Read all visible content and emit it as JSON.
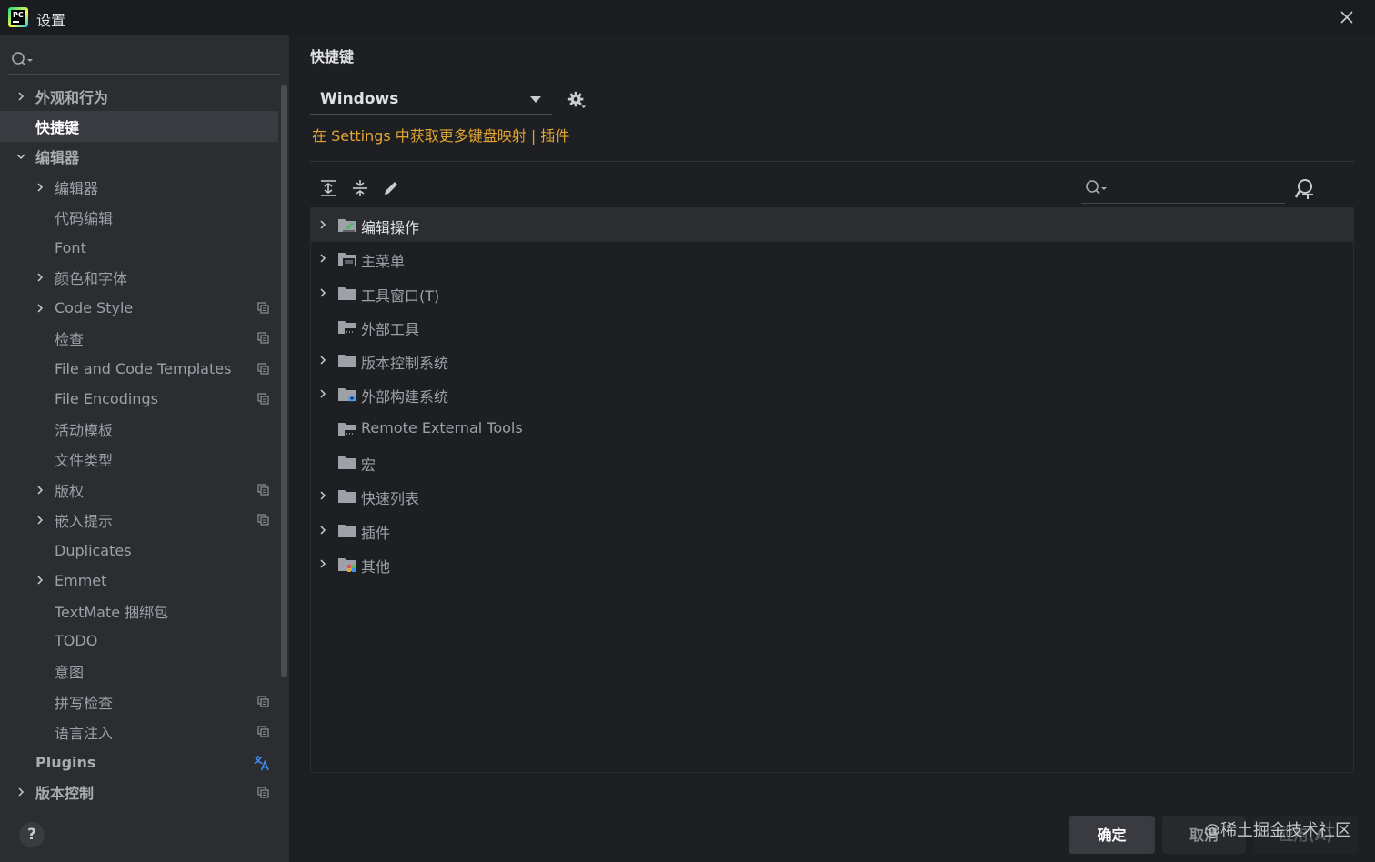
{
  "window": {
    "title": "设置",
    "app_icon": "pycharm-logo",
    "app_icon_text": "PC"
  },
  "colors": {
    "accent_link": "#e0a533",
    "background": "#1e1f22",
    "sidebar": "#2b2d30",
    "selection": "#393b40"
  },
  "left_search": {
    "placeholder": "",
    "icon": "search-icon"
  },
  "nav": [
    {
      "label": "外观和行为",
      "level": 0,
      "expandable": true,
      "expanded": false
    },
    {
      "label": "快捷键",
      "level": 0,
      "selected": true
    },
    {
      "label": "编辑器",
      "level": 0,
      "expandable": true,
      "expanded": true
    },
    {
      "label": "编辑器",
      "level": 1,
      "expandable": true
    },
    {
      "label": "代码编辑",
      "level": 1
    },
    {
      "label": "Font",
      "level": 1
    },
    {
      "label": "颜色和字体",
      "level": 1,
      "expandable": true
    },
    {
      "label": "Code Style",
      "level": 1,
      "expandable": true,
      "badge": "project-scope-icon"
    },
    {
      "label": "检查",
      "level": 1,
      "badge": "project-scope-icon"
    },
    {
      "label": "File and Code Templates",
      "level": 1,
      "badge": "project-scope-icon"
    },
    {
      "label": "File Encodings",
      "level": 1,
      "badge": "project-scope-icon"
    },
    {
      "label": "活动模板",
      "level": 1
    },
    {
      "label": "文件类型",
      "level": 1
    },
    {
      "label": "版权",
      "level": 1,
      "expandable": true,
      "badge": "project-scope-icon"
    },
    {
      "label": "嵌入提示",
      "level": 1,
      "expandable": true,
      "badge": "project-scope-icon"
    },
    {
      "label": "Duplicates",
      "level": 1
    },
    {
      "label": "Emmet",
      "level": 1,
      "expandable": true
    },
    {
      "label": "TextMate 捆绑包",
      "level": 1
    },
    {
      "label": "TODO",
      "level": 1
    },
    {
      "label": "意图",
      "level": 1
    },
    {
      "label": "拼写检查",
      "level": 1,
      "badge": "project-scope-icon"
    },
    {
      "label": "语言注入",
      "level": 1,
      "badge": "project-scope-icon"
    },
    {
      "label": "Plugins",
      "level": 0,
      "badge": "translate-icon"
    },
    {
      "label": "版本控制",
      "level": 0,
      "expandable": true,
      "badge": "project-scope-icon"
    }
  ],
  "help": {
    "label": "?"
  },
  "main": {
    "title": "快捷键",
    "keymap_select": {
      "value": "Windows"
    },
    "get_more_link": "在 Settings 中获取更多键盘映射 | 插件",
    "toolbar": {
      "icons": [
        "expand-all-icon",
        "collapse-all-icon",
        "edit-icon"
      ],
      "search_placeholder": "",
      "find_shortcut_icon": "find-by-shortcut-icon"
    },
    "actions": [
      {
        "label": "编辑操作",
        "expandable": true,
        "icon": "editor-actions-folder-icon",
        "highlighted": true
      },
      {
        "label": "主菜单",
        "expandable": true,
        "icon": "main-menu-folder-icon"
      },
      {
        "label": "工具窗口(T)",
        "expandable": true,
        "icon": "folder-icon"
      },
      {
        "label": "外部工具",
        "expandable": false,
        "icon": "external-tools-folder-icon"
      },
      {
        "label": "版本控制系统",
        "expandable": true,
        "icon": "folder-icon"
      },
      {
        "label": "外部构建系统",
        "expandable": true,
        "icon": "build-system-folder-icon"
      },
      {
        "label": "Remote External Tools",
        "expandable": false,
        "icon": "external-tools-folder-icon"
      },
      {
        "label": "宏",
        "expandable": false,
        "icon": "folder-icon"
      },
      {
        "label": "快速列表",
        "expandable": true,
        "icon": "folder-icon"
      },
      {
        "label": "插件",
        "expandable": true,
        "icon": "folder-icon"
      },
      {
        "label": "其他",
        "expandable": true,
        "icon": "other-folder-icon"
      }
    ]
  },
  "buttons": {
    "ok": "确定",
    "cancel": "取消",
    "apply": "应用(A)"
  },
  "watermark": "@稀土掘金技术社区"
}
